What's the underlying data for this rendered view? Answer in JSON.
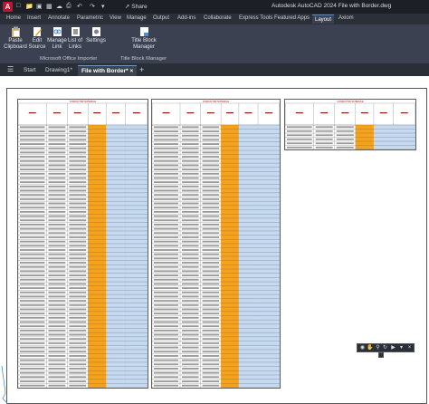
{
  "titlebar": {
    "logo": "A",
    "share_label": "Share",
    "window_title": "Autodesk AutoCAD 2024   File with Border.dwg"
  },
  "ribbon_tabs": [
    "Home",
    "Insert",
    "Annotate",
    "Parametric",
    "View",
    "Manage",
    "Output",
    "Add-ins",
    "Collaborate",
    "Express Tools",
    "Featured Apps",
    "Layout",
    "Axiom"
  ],
  "ribbon_active_tab": "Layout",
  "ribbon": {
    "paste_clipboard": [
      "Paste",
      "Clipboard"
    ],
    "edit_source": [
      "Edit",
      "Source"
    ],
    "manage_link": [
      "Manage",
      "Link"
    ],
    "list_of_links": [
      "List of",
      "Links"
    ],
    "settings": "Settings",
    "title_block_manager": [
      "Title Block",
      "Manager"
    ],
    "group_office": "Microsoft Office Importer",
    "group_title_block": "Title Block Manager"
  },
  "doc_tabs": {
    "start": "Start",
    "drawing1": "Drawing1*",
    "file_with_border": "File with Border*"
  },
  "colors": {
    "blue_fill": "#c5d9f1",
    "orange_fill": "#f7a21b",
    "header_red": "#c00000"
  },
  "sheets": [
    {
      "rows": 62,
      "header_text": "CONDUCTOR SCHEDULE"
    },
    {
      "rows": 62,
      "header_text": "CONDUCTOR SCHEDULE"
    },
    {
      "rows": 6,
      "header_text": "CONDUCTOR SCHEDULE"
    }
  ]
}
